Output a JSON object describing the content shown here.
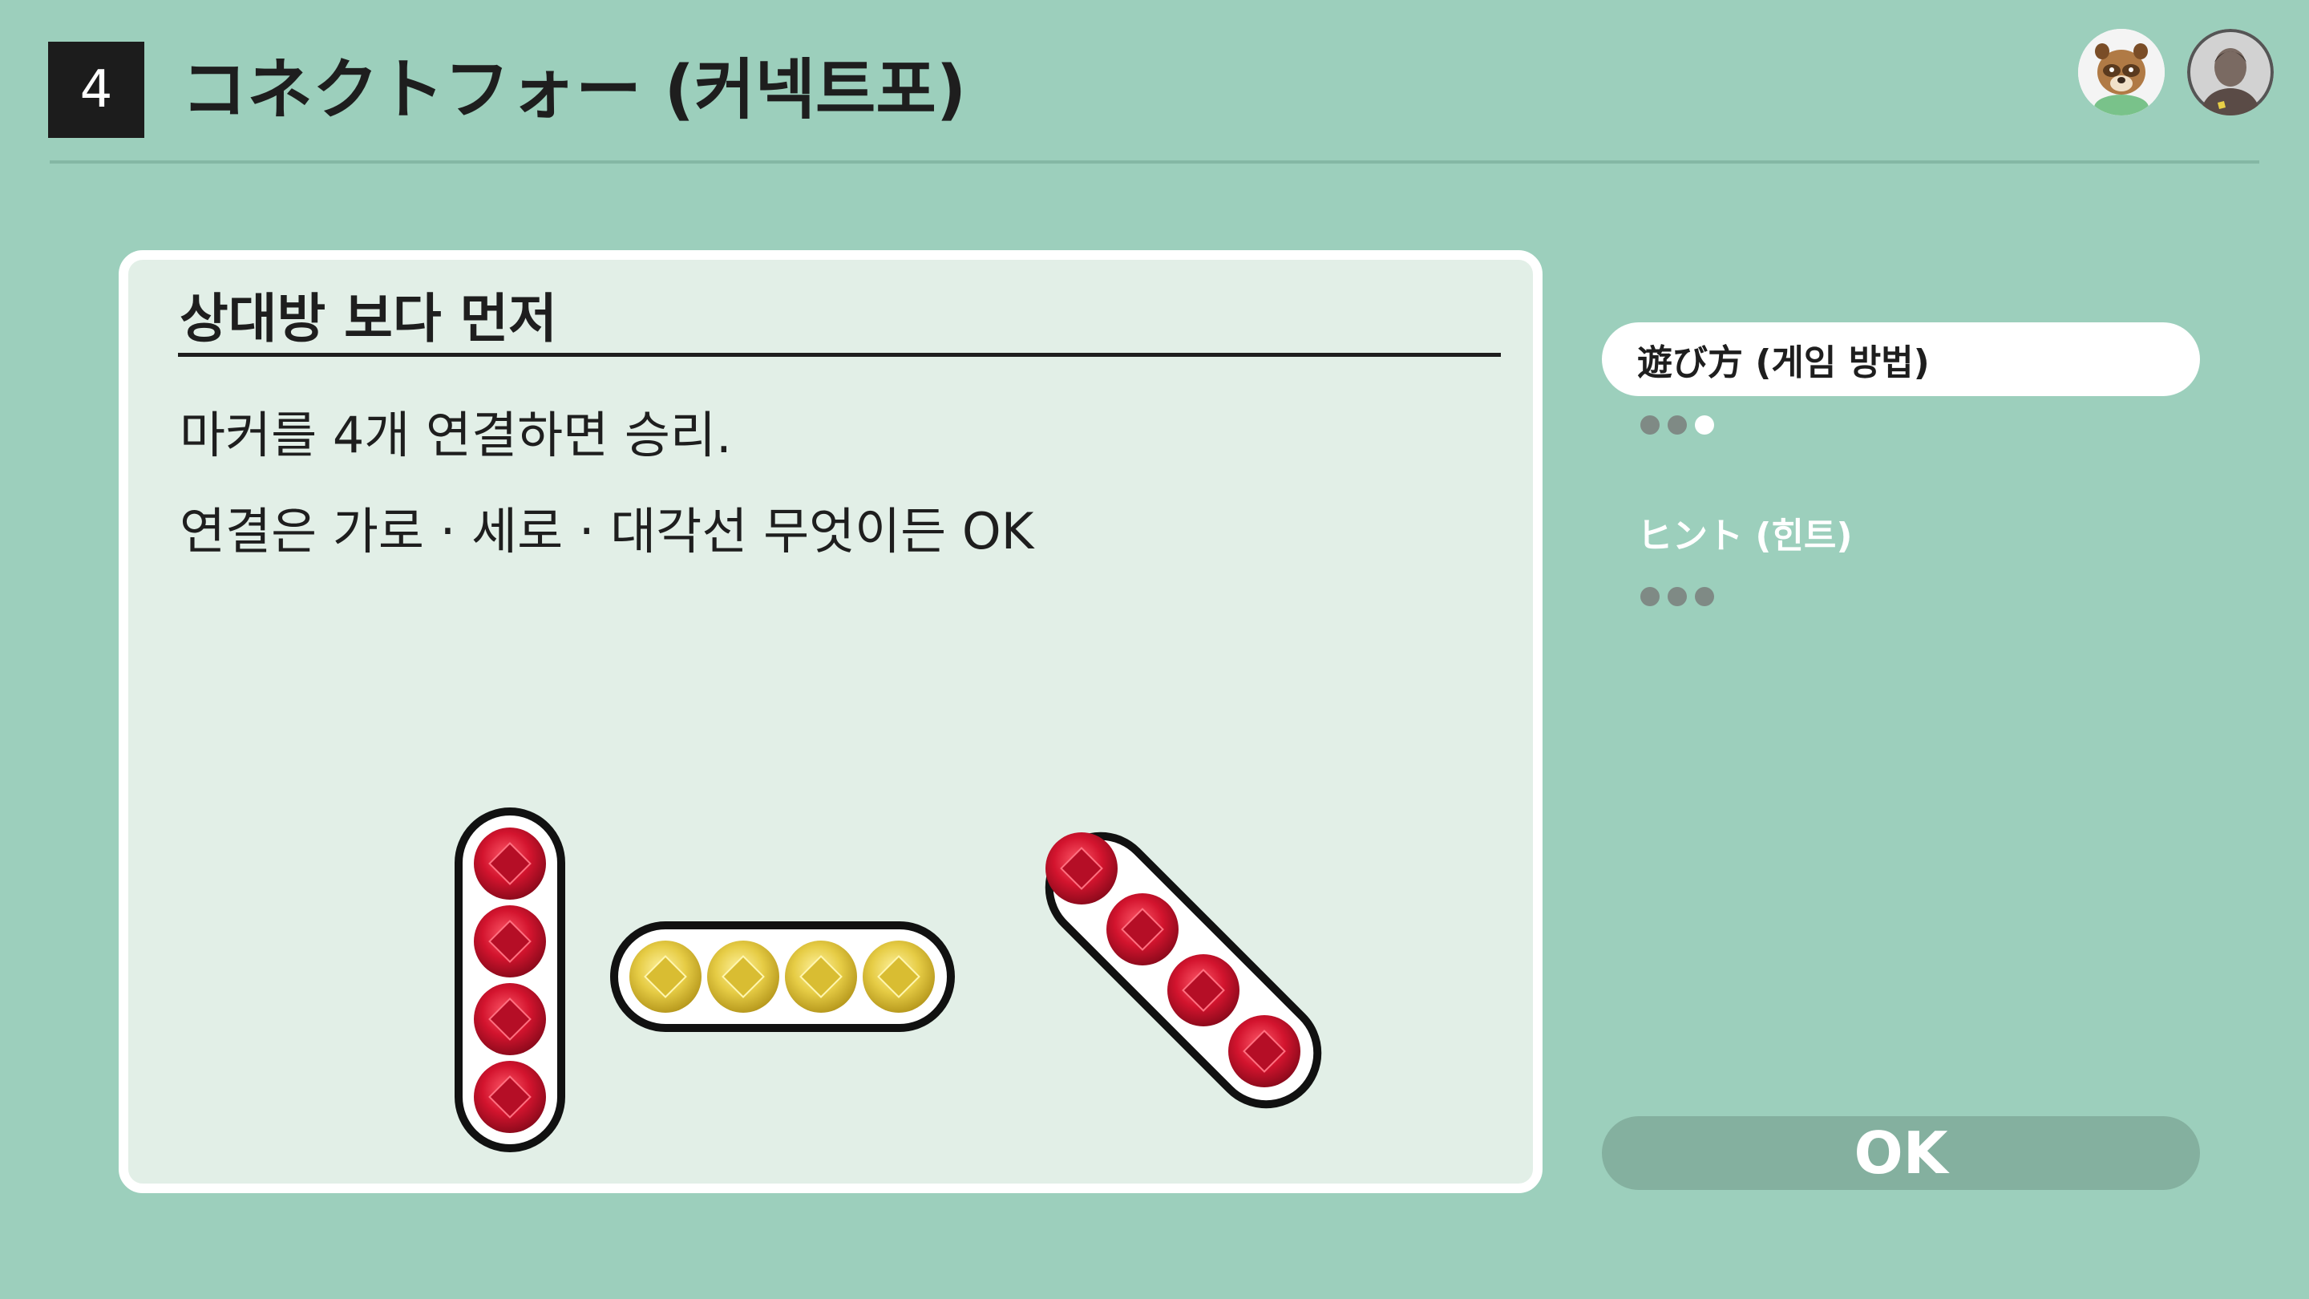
{
  "header": {
    "number": "4",
    "title": "コネクトフォー (커넥트포)"
  },
  "panel": {
    "title": "상대방 보다 먼저",
    "line1": "마커를 4개 연결하면 승리.",
    "line2": "연결은 가로 · 세로 · 대각선 무엇이든 OK"
  },
  "menu": {
    "items": [
      {
        "label": "遊び方 (게임 방법)",
        "state": "selected",
        "dots": 3,
        "dots_active": 1
      },
      {
        "label": "ヒント (힌트)",
        "state": "unselected",
        "dots": 3,
        "dots_active": 0
      }
    ]
  },
  "ok_button": {
    "label": "OK"
  },
  "icons": {
    "avatar1": "tanuki-villager-avatar-icon",
    "avatar2": "player-avatar-icon",
    "marker_red": "red-marker-icon",
    "marker_yellow": "yellow-marker-icon"
  },
  "colors": {
    "background": "#9ccfbc",
    "panel": "#e2efe7",
    "marker_red": "#c8102e",
    "marker_yellow": "#e8cf47",
    "ok_button": "#84b09f"
  }
}
